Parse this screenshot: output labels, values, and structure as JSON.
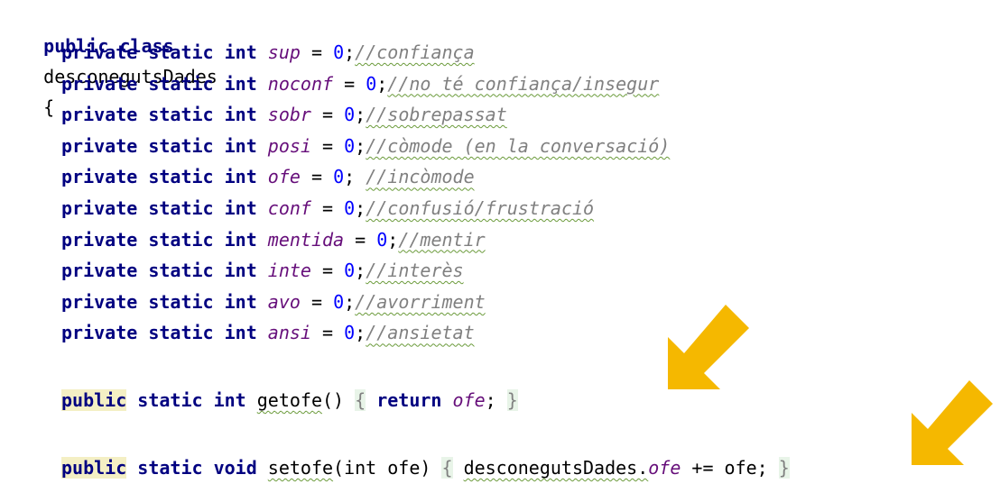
{
  "class_decl": {
    "modifiers": "public class",
    "name": "desconegutsDades",
    "open_brace": "{"
  },
  "fields": [
    {
      "modifiers": "private static int",
      "name": "sup",
      "init": "= ",
      "value": "0",
      "semi": ";",
      "comment": "//confiança"
    },
    {
      "modifiers": "private static int",
      "name": "noconf",
      "init": "= ",
      "value": "0",
      "semi": ";",
      "comment": "//no té confiança/insegur"
    },
    {
      "modifiers": "private static int",
      "name": "sobr",
      "init": "= ",
      "value": "0",
      "semi": ";",
      "comment": "//sobrepassat"
    },
    {
      "modifiers": "private static int",
      "name": "posi",
      "init": "= ",
      "value": "0",
      "semi": ";",
      "comment": "//còmode (en la conversació)"
    },
    {
      "modifiers": "private static int",
      "name": "ofe",
      "init": "= ",
      "value": "0",
      "semi": "; ",
      "comment": "//incòmode"
    },
    {
      "modifiers": "private static int",
      "name": "conf",
      "init": "= ",
      "value": "0",
      "semi": ";",
      "comment": "//confusió/frustració"
    },
    {
      "modifiers": "private static int",
      "name": "mentida",
      "init": "= ",
      "value": "0",
      "semi": ";",
      "comment": "//mentir"
    },
    {
      "modifiers": "private static int",
      "name": "inte",
      "init": "= ",
      "value": "0",
      "semi": ";",
      "comment": "//interès"
    },
    {
      "modifiers": "private static int",
      "name": "avo",
      "init": "= ",
      "value": "0",
      "semi": ";",
      "comment": "//avorriment"
    },
    {
      "modifiers": "private static int",
      "name": "ansi",
      "init": "= ",
      "value": "0",
      "semi": ";",
      "comment": "//ansietat"
    }
  ],
  "getter": {
    "public": "public",
    "rest": " static int ",
    "name": "getofe",
    "params": "() ",
    "open": "{",
    "return_kw": "return",
    "field": "ofe",
    "semi": "; ",
    "close": "}"
  },
  "setter": {
    "public": "public",
    "rest": " static void ",
    "name": "setofe",
    "params": "(int ofe) ",
    "open": "{",
    "class_ref": "desconegutsDades.",
    "field": "ofe",
    "op": " += ofe; ",
    "close": "}"
  },
  "colors": {
    "keyword": "#000080",
    "field": "#660e7a",
    "number": "#0000ff",
    "comment": "#808080",
    "arrow": "#f5b800"
  },
  "annotations": [
    "arrow-icon",
    "arrow-icon"
  ]
}
